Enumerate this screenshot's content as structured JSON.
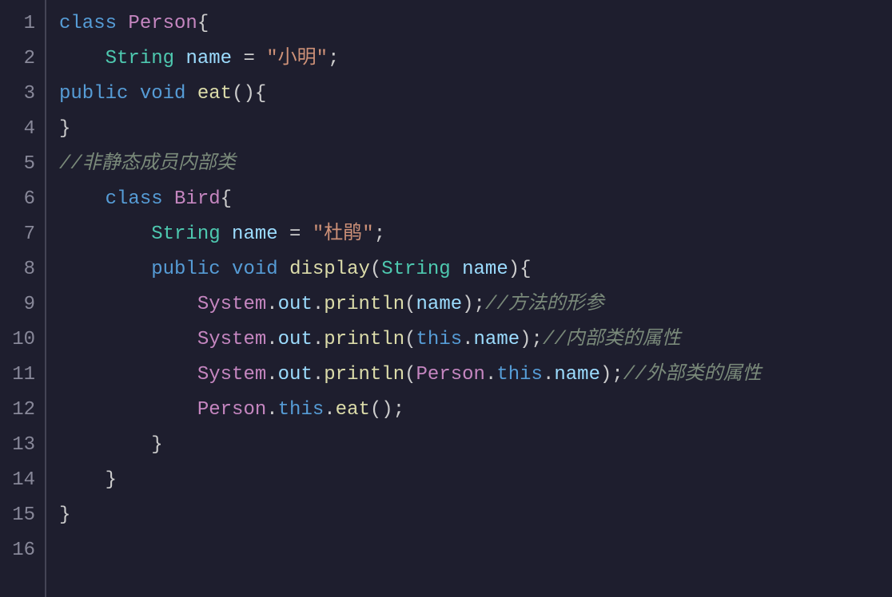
{
  "lineNumbers": [
    "1",
    "2",
    "3",
    "4",
    "5",
    "6",
    "7",
    "8",
    "9",
    "10",
    "11",
    "12",
    "13",
    "14",
    "15",
    "16"
  ],
  "code": {
    "l1": {
      "kw_class": "class",
      "name": "Person",
      "brace": "{"
    },
    "l2": {
      "type": "String",
      "var": "name",
      "eq": " = ",
      "str": "\"小明\"",
      "semi": ";"
    },
    "l3": {
      "kw_public": "public",
      "kw_void": "void",
      "method": "eat",
      "parens": "()",
      "brace": "{"
    },
    "l4": {
      "brace": "}"
    },
    "l5": {
      "comment": "//非静态成员内部类"
    },
    "l6": {
      "kw_class": "class",
      "name": "Bird",
      "brace": "{"
    },
    "l7": {
      "type": "String",
      "var": "name",
      "eq": " = ",
      "str": "\"杜鹃\"",
      "semi": ";"
    },
    "l8": {
      "kw_public": "public",
      "kw_void": "void",
      "method": "display",
      "lp": "(",
      "ptype": "String",
      "pname": "name",
      "rp": ")",
      "brace": "{"
    },
    "l9": {
      "sys": "System",
      "dot1": ".",
      "out": "out",
      "dot2": ".",
      "println": "println",
      "lp": "(",
      "arg": "name",
      "rp": ")",
      "semi": ";",
      "comment": "//方法的形参"
    },
    "l10": {
      "sys": "System",
      "dot1": ".",
      "out": "out",
      "dot2": ".",
      "println": "println",
      "lp": "(",
      "this": "this",
      "dot3": ".",
      "prop": "name",
      "rp": ")",
      "semi": ";",
      "comment": "//内部类的属性"
    },
    "l11": {
      "sys": "System",
      "dot1": ".",
      "out": "out",
      "dot2": ".",
      "println": "println",
      "lp": "(",
      "person": "Person",
      "dot3": ".",
      "this": "this",
      "dot4": ".",
      "prop": "name",
      "rp": ")",
      "semi": ";",
      "comment": "//外部类的属性"
    },
    "l12": {
      "person": "Person",
      "dot1": ".",
      "this": "this",
      "dot2": ".",
      "method": "eat",
      "parens": "()",
      "semi": ";"
    },
    "l13": {
      "brace": "}"
    },
    "l14": {
      "brace": "}"
    },
    "l15": {
      "brace": "}"
    }
  }
}
